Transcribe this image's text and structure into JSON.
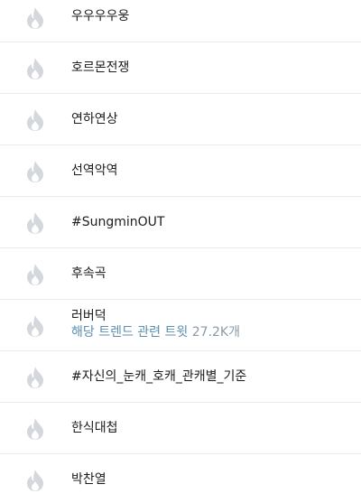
{
  "trends": [
    {
      "title": "우우우우웅"
    },
    {
      "title": "호르몬전쟁"
    },
    {
      "title": "연하연상"
    },
    {
      "title": "선역악역"
    },
    {
      "title": "#SungminOUT"
    },
    {
      "title": "후속곡"
    },
    {
      "title": "러버덕",
      "related_label": "해당 트렌드 관련 트윗",
      "related_count": "27.2K개"
    },
    {
      "title": "#자신의_눈캐_호캐_관캐별_기준"
    },
    {
      "title": "한식대첩"
    },
    {
      "title": "박찬열"
    }
  ],
  "icon": "flame-icon",
  "colors": {
    "icon": "#d4d8dc",
    "divider": "#e6ecf0",
    "related_text": "#5b8fb0"
  }
}
